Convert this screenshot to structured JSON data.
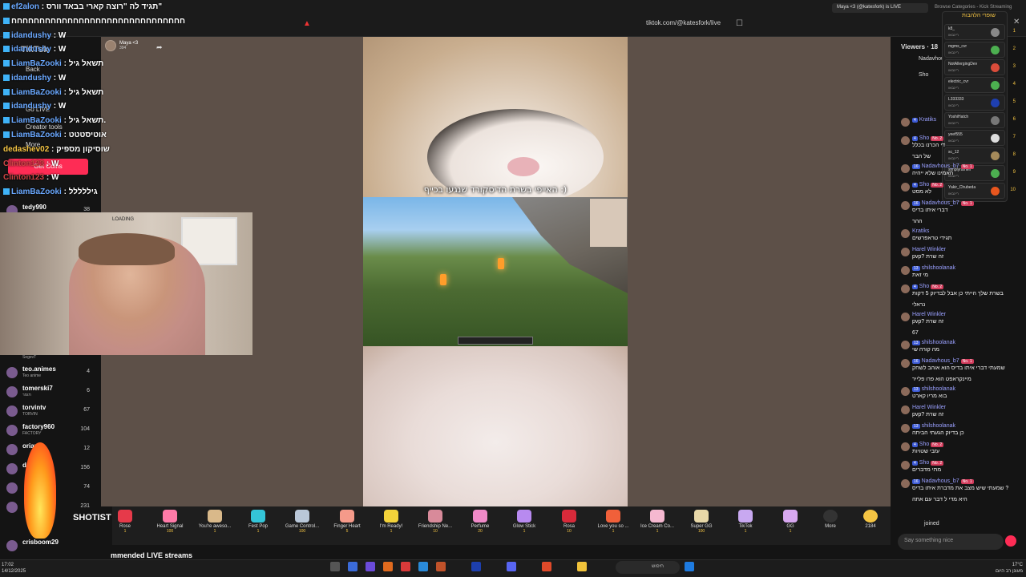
{
  "browser": {
    "url": "tiktok.com/@katesfork/live",
    "tab_active": "Maya <3 (@katesfork) is LIVE",
    "tab_next": "Browse Categories - Kick Streaming"
  },
  "streamer": {
    "name": "Maya <3",
    "count": "394"
  },
  "video": {
    "caption": "האייפי בשרת הדיסקורד שנגעו בכייף :)"
  },
  "left_chat": [
    {
      "user": "ef2alon",
      "msg": "תגיד לה \"רוצה קארי בבאד וורס\""
    },
    {
      "user": "",
      "msg": "חחחחחחחחחחחחחחחחחחחחחחחחחחחחחחח"
    },
    {
      "user": "idandushy",
      "msg": "W"
    },
    {
      "user": "idandushy",
      "msg": "W"
    },
    {
      "user": "LiamBaZooki",
      "msg": "תשאל גיל"
    },
    {
      "user": "idandushy",
      "msg": "W"
    },
    {
      "user": "LiamBaZooki",
      "msg": "תשאל גיל"
    },
    {
      "user": "idandushy",
      "msg": "W"
    },
    {
      "user": "LiamBaZooki",
      "msg": "תשאל גיל."
    },
    {
      "user": "LiamBaZooki",
      "msg": "אוטיסטטט"
    },
    {
      "user": "dedashev02",
      "msg": "שוסיקון מספיק"
    },
    {
      "user": "Clinton123",
      "msg": "W"
    },
    {
      "user": "Clinton123",
      "msg": "W"
    },
    {
      "user": "LiamBaZooki",
      "msg": "גיללללל"
    }
  ],
  "nav": {
    "tiktok": "TikTok",
    "back": "Back",
    "go_live": "Go LIVE",
    "creator_tools": "Creator tools",
    "more": "More",
    "get_coins": "Get Coins"
  },
  "webcam": {
    "loading": "LOADING"
  },
  "following": [
    {
      "name": "tedy990",
      "sub": "",
      "count": "38"
    },
    {
      "name": "SegevT",
      "sub": "",
      "count": ""
    },
    {
      "name": "teo.animes",
      "sub": "Teo anime",
      "count": "4"
    },
    {
      "name": "tomerski7",
      "sub": "תומר",
      "count": "6"
    },
    {
      "name": "torvintv",
      "sub": "TORVIN",
      "count": "67"
    },
    {
      "name": "factory960",
      "sub": "FACTORY",
      "count": "104"
    },
    {
      "name": "orian",
      "sub": "",
      "count": "12"
    },
    {
      "name": "d",
      "sub": "",
      "count": "156"
    },
    {
      "name": "",
      "sub": "",
      "count": "74"
    },
    {
      "name": "",
      "sub": "",
      "count": "231"
    },
    {
      "name": "crisboom29",
      "sub": "",
      "count": ""
    }
  ],
  "shotist": "SHOTIST",
  "recommended": "mmended LIVE streams",
  "gifts": [
    {
      "label": "Rose",
      "price": "1"
    },
    {
      "label": "Heart Signal",
      "price": "100"
    },
    {
      "label": "You're aweso...",
      "price": "1"
    },
    {
      "label": "Fest Pop",
      "price": "1"
    },
    {
      "label": "Game Control...",
      "price": "100"
    },
    {
      "label": "Finger Heart",
      "price": "5"
    },
    {
      "label": "I'm Ready!",
      "price": "1"
    },
    {
      "label": "Friendship Ne...",
      "price": "10"
    },
    {
      "label": "Perfume",
      "price": "20"
    },
    {
      "label": "Glow Stick",
      "price": "1"
    },
    {
      "label": "Rosa",
      "price": "10"
    },
    {
      "label": "Love you so ...",
      "price": "1"
    },
    {
      "label": "Ice Cream Co...",
      "price": "1"
    },
    {
      "label": "Super GG",
      "price": "100"
    },
    {
      "label": "TikTok",
      "price": "1"
    },
    {
      "label": "GG",
      "price": "1"
    },
    {
      "label": "More",
      "price": ""
    }
  ],
  "coin_balance": "2184",
  "viewers": {
    "title": "Viewers · 18",
    "rows": [
      "Nadavhous_b7",
      "Sho"
    ]
  },
  "ranking": {
    "title": "שופרי הלהבות",
    "items": [
      {
        "name": "k8_",
        "sub": "ריינבואו",
        "pos": "1"
      },
      {
        "name": "mgms_cvr",
        "sub": "ריינבואו",
        "pos": "2"
      },
      {
        "name": "NotAllergingDev",
        "sub": "ריינבואו",
        "pos": "3"
      },
      {
        "name": "electric_cvr",
        "sub": "ריינבואו",
        "pos": "4"
      },
      {
        "name": "L333333",
        "sub": "ריינבואו",
        "pos": "5"
      },
      {
        "name": "YoshiHatch",
        "sub": "ריינבואו",
        "pos": "6"
      },
      {
        "name": "yeef555",
        "sub": "ריינבואו",
        "pos": "7"
      },
      {
        "name": "sc_12",
        "sub": "ריינבואו",
        "pos": "8"
      },
      {
        "name": "simplyramen",
        "sub": "ריינבואו",
        "pos": "9"
      },
      {
        "name": "Yakir_Chubeda",
        "sub": "ריינבואו",
        "pos": "10"
      }
    ]
  },
  "chat": [
    {
      "lvl": "4",
      "user": "Kratiks",
      "badge": "",
      "msg": ""
    },
    {
      "lvl": "4",
      "user": "Sho",
      "badge": "No. 2",
      "msg": "די הכרנו בכלל"
    },
    {
      "lvl": "",
      "user": "",
      "badge": "",
      "msg": "של הבר"
    },
    {
      "lvl": "16",
      "user": "Nadavhous_b7",
      "badge": "No. 1",
      "msg": "האמינו שלא ייהיה"
    },
    {
      "lvl": "4",
      "user": "Sho",
      "badge": "No. 2",
      "msg": "לא מסט"
    },
    {
      "lvl": "16",
      "user": "Nadavhous_b7",
      "badge": "No. 1",
      "msg": "דברי איתו בדיס"
    },
    {
      "lvl": "",
      "user": "",
      "badge": "",
      "msg": "ההר"
    },
    {
      "lvl": "",
      "user": "Kratiks",
      "badge": "",
      "msg": "תגידי טראפרשים"
    },
    {
      "lvl": "",
      "user": "Harel Winkler",
      "badge": "",
      "msg": "pvp? זה שרת"
    },
    {
      "lvl": "13",
      "user": "shilshoolanak",
      "badge": "",
      "msg": "מי זאת"
    },
    {
      "lvl": "4",
      "user": "Sho",
      "badge": "No. 2",
      "msg": "בשרת שלך הייתי כן אבל לבדיוק 5 דקות"
    },
    {
      "lvl": "",
      "user": "",
      "badge": "",
      "msg": "נראלי"
    },
    {
      "lvl": "",
      "user": "Harel Winkler",
      "badge": "",
      "msg": "pvp? זה שרת"
    },
    {
      "lvl": "",
      "user": "",
      "badge": "",
      "msg": "67"
    },
    {
      "lvl": "13",
      "user": "shilshoolanak",
      "badge": "",
      "msg": "מה קורה שי"
    },
    {
      "lvl": "16",
      "user": "Nadavhous_b7",
      "badge": "No. 1",
      "msg": "שמעתי דברי איתו בדיס הוא אוהב לשחק"
    },
    {
      "lvl": "",
      "user": "",
      "badge": "",
      "msg": "מיינקראפט הוא פרו פלייר"
    },
    {
      "lvl": "13",
      "user": "shilshoolanak",
      "badge": "",
      "msg": "בוא מריו קארט"
    },
    {
      "lvl": "",
      "user": "Harel Winkler",
      "badge": "",
      "msg": "pvp? זה שרת"
    },
    {
      "lvl": "13",
      "user": "shilshoolanak",
      "badge": "",
      "msg": "כן בדיוק הגעתי הביתה"
    },
    {
      "lvl": "4",
      "user": "Sho",
      "badge": "No. 2",
      "msg": "עזבי שטויות"
    },
    {
      "lvl": "4",
      "user": "Sho",
      "badge": "No. 2",
      "msg": "מתי מדברים"
    },
    {
      "lvl": "16",
      "user": "Nadavhous_b7",
      "badge": "No. 1",
      "msg": "שמעתי שיש מצב את מדברת איתו בדיס ?"
    },
    {
      "lvl": "",
      "user": "",
      "badge": "",
      "msg": "היא מדי ל דבר עם אתה"
    }
  ],
  "joined": "joined",
  "chat_input": "Say something nice",
  "taskbar": {
    "time": "17:02",
    "date": "14/12/2025",
    "search": "חיפוש",
    "weather": "17°C",
    "weather_sub": "מעונן רב היום"
  },
  "colors": {
    "accent": "#fe2c55",
    "link": "#6aa8ff"
  }
}
